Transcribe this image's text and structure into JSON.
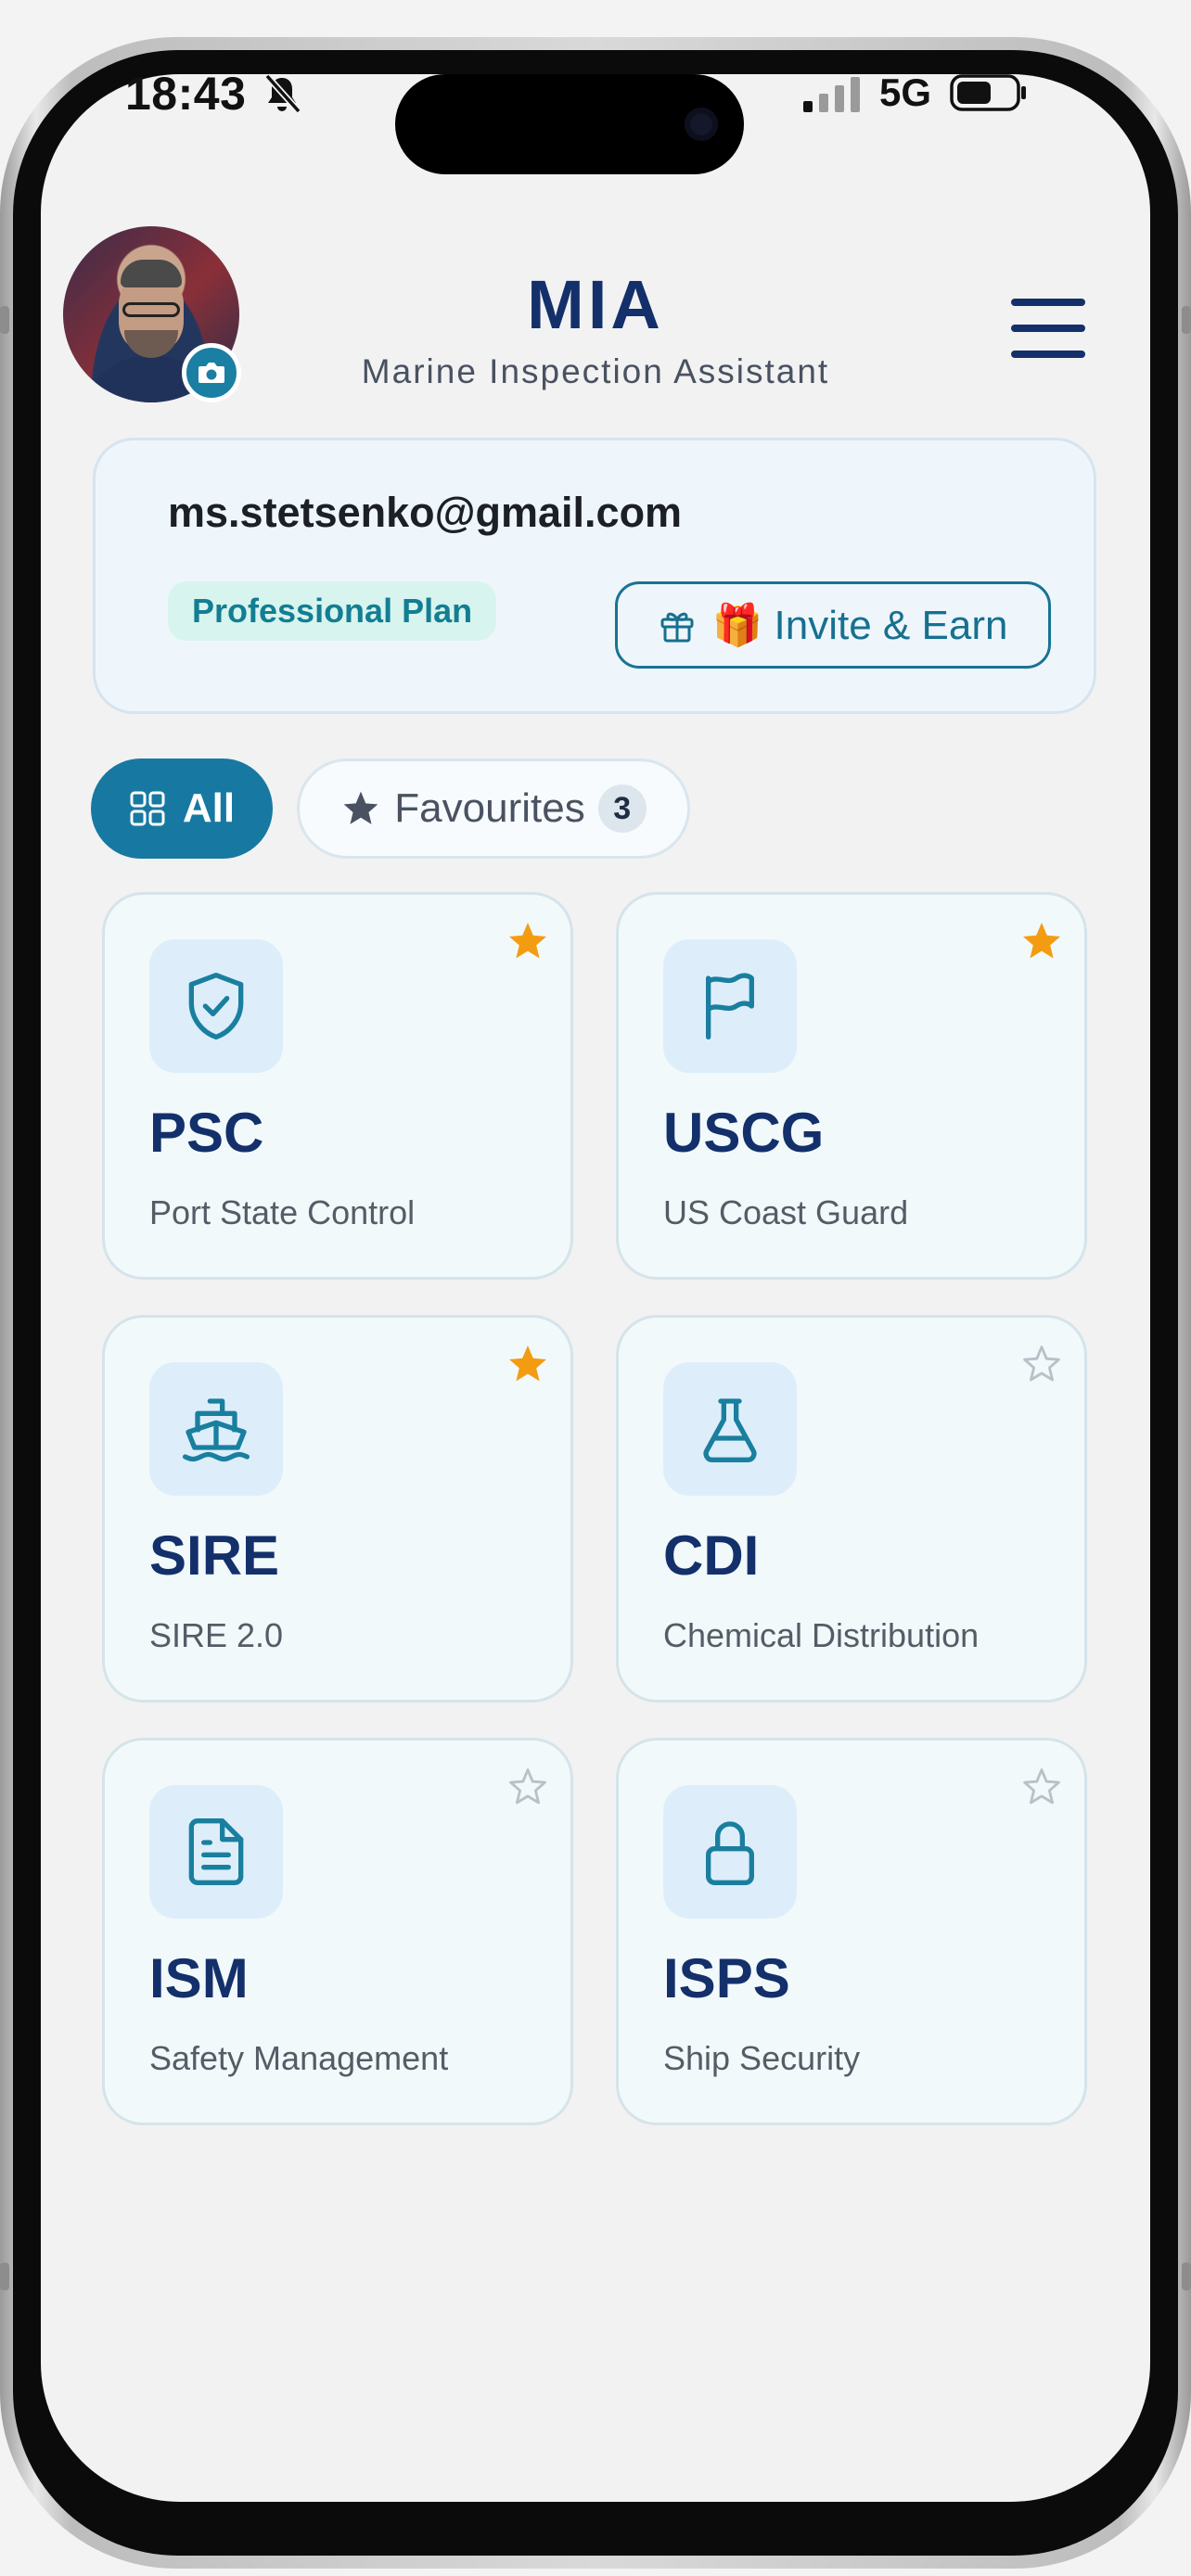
{
  "status_bar": {
    "time": "18:43",
    "network": "5G"
  },
  "header": {
    "title": "MIA",
    "subtitle": "Marine Inspection Assistant"
  },
  "account": {
    "email": "ms.stetsenko@gmail.com",
    "plan": "Professional Plan",
    "invite_label": "🎁 Invite & Earn"
  },
  "filters": {
    "all_label": "All",
    "favourites_label": "Favourites",
    "favourites_count": "3",
    "active": "All"
  },
  "modules": [
    {
      "code": "PSC",
      "name": "Port State Control",
      "icon": "shield-check-icon",
      "favourite": true
    },
    {
      "code": "USCG",
      "name": "US Coast Guard",
      "icon": "flag-icon",
      "favourite": true
    },
    {
      "code": "SIRE",
      "name": "SIRE 2.0",
      "icon": "ship-icon",
      "favourite": true
    },
    {
      "code": "CDI",
      "name": "Chemical Distribution",
      "icon": "flask-icon",
      "favourite": false
    },
    {
      "code": "ISM",
      "name": "Safety Management",
      "icon": "document-icon",
      "favourite": false
    },
    {
      "code": "ISPS",
      "name": "Ship Security",
      "icon": "lock-icon",
      "favourite": false
    }
  ],
  "colors": {
    "primary": "#14306B",
    "accent": "#1779A1",
    "star_active": "#F39C12",
    "star_inactive": "#B8C0C8"
  }
}
